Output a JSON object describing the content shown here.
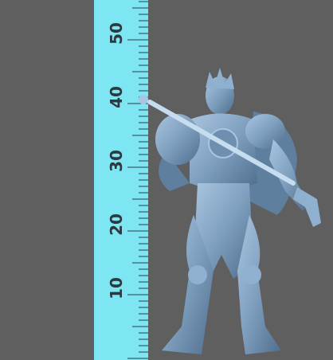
{
  "scene": {
    "description_colors": {
      "background": "#5f5f5f",
      "ruler": "#7ee5f2",
      "figure": "#7f9fbf"
    }
  },
  "ruler": {
    "labels": [
      "10",
      "20",
      "30",
      "40",
      "50"
    ]
  }
}
